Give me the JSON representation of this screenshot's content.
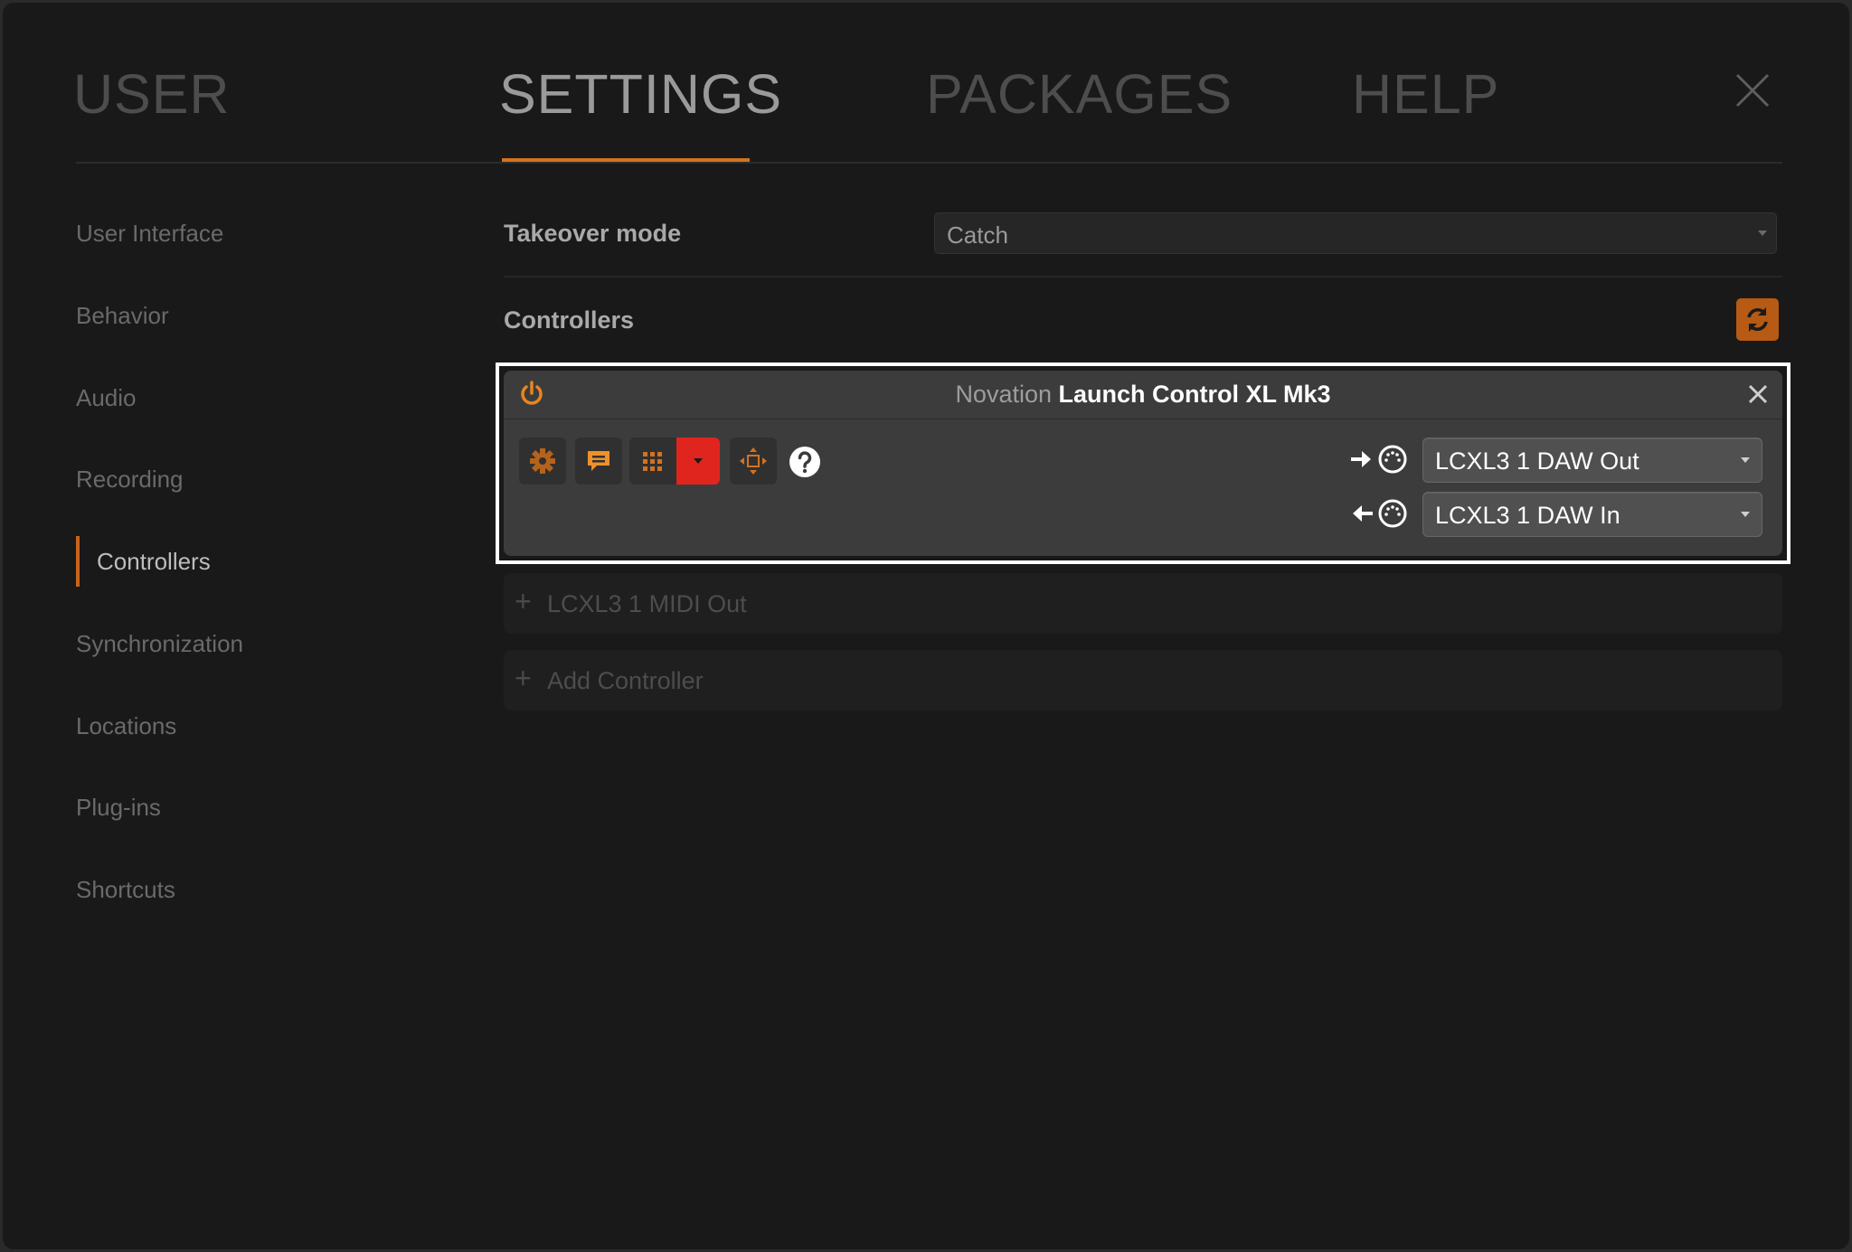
{
  "tabs": [
    {
      "label": "USER"
    },
    {
      "label": "SETTINGS"
    },
    {
      "label": "PACKAGES"
    },
    {
      "label": "HELP"
    }
  ],
  "sidebar": {
    "items": [
      {
        "label": "User Interface"
      },
      {
        "label": "Behavior"
      },
      {
        "label": "Audio"
      },
      {
        "label": "Recording"
      },
      {
        "label": "Controllers"
      },
      {
        "label": "Synchronization"
      },
      {
        "label": "Locations"
      },
      {
        "label": "Plug-ins"
      },
      {
        "label": "Shortcuts"
      }
    ],
    "active": "Controllers"
  },
  "main": {
    "takeover_label": "Takeover mode",
    "takeover_value": "Catch",
    "controllers_label": "Controllers",
    "controller": {
      "vendor": "Novation",
      "model": "Launch Control XL Mk3",
      "output_port": "LCXL3 1 DAW Out",
      "input_port": "LCXL3 1 DAW In"
    },
    "add_port_label": "LCXL3 1 MIDI Out",
    "add_controller_label": "Add Controller"
  },
  "colors": {
    "accent": "#d4721f",
    "refresh_button": "#b65a14",
    "red_button": "#e0251f",
    "background": "#191919"
  },
  "icons": [
    "close-icon",
    "refresh-icon",
    "power-icon",
    "gear-icon",
    "speech-bubble-icon",
    "grid-icon",
    "dropdown-arrow-icon",
    "move-icon",
    "help-icon",
    "midi-port-icon"
  ]
}
